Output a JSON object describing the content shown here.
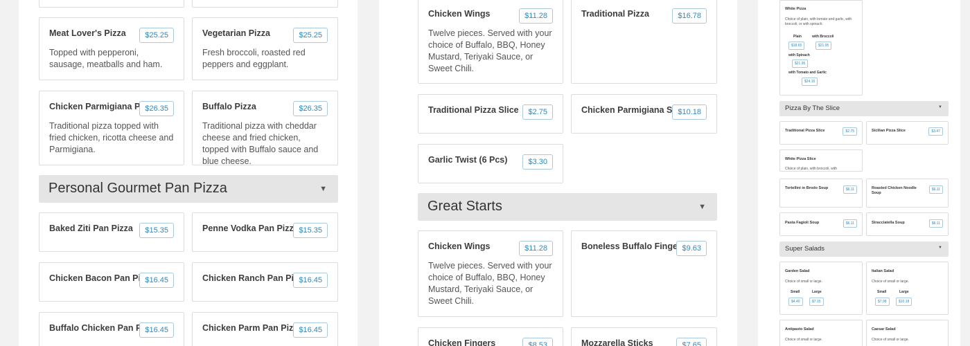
{
  "left": {
    "cards": [
      {
        "name": "Meat Lover's Pizza",
        "price": "$25.25",
        "desc": "Topped with pepperoni, sausage, meatballs and ham."
      },
      {
        "name": "Vegetarian Pizza",
        "price": "$25.25",
        "desc": "Fresh broccoli, roasted red peppers and eggplant."
      },
      {
        "name": "Chicken Parmigiana Pizza",
        "price": "$26.35",
        "desc": "Traditional pizza topped with fried chicken, ricotta cheese and Parmigiana."
      },
      {
        "name": "Buffalo Pizza",
        "price": "$26.35",
        "desc": "Traditional pizza with cheddar cheese and fried chicken, topped with Buffalo sauce and blue cheese."
      }
    ],
    "section": {
      "title": "Personal Gourmet Pan Pizza",
      "caret": "▼"
    },
    "pan_cards": [
      {
        "name": "Baked Ziti Pan Pizza",
        "price": "$15.35"
      },
      {
        "name": "Penne Vodka Pan Pizza",
        "price": "$15.35"
      },
      {
        "name": "Chicken Bacon Pan Pizza",
        "price": "$16.45"
      },
      {
        "name": "Chicken Ranch Pan Pizza",
        "price": "$16.45"
      },
      {
        "name": "Buffalo Chicken Pan Pizza",
        "price": "$16.45"
      },
      {
        "name": "Chicken Parm Pan Pizza",
        "price": "$16.45"
      }
    ]
  },
  "mid": {
    "cards_top": [
      {
        "name": "Chicken Wings",
        "price": "$11.28",
        "desc": "Twelve pieces. Served with your choice of Buffalo, BBQ, Honey Mustard, Teriyaki Sauce, or Sweet Chili."
      },
      {
        "name": "Traditional Pizza",
        "price": "$16.78"
      },
      {
        "name": "Traditional Pizza Slice",
        "price": "$2.75"
      },
      {
        "name": "Chicken Parmigiana Sub",
        "price": "$10.18"
      },
      {
        "name": "Garlic Twist (6 Pcs)",
        "price": "$3.30"
      }
    ],
    "section": {
      "title": "Great Starts",
      "caret": "▼"
    },
    "starts_cards": [
      {
        "name": "Chicken Wings",
        "price": "$11.28",
        "desc": "Twelve pieces. Served with your choice of Buffalo, BBQ, Honey Mustard, Teriyaki Sauce, or Sweet Chili."
      },
      {
        "name": "Boneless Buffalo Fingers",
        "price": "$9.63"
      },
      {
        "name": "Chicken Fingers",
        "price": "$8.53"
      },
      {
        "name": "Mozzarella Sticks",
        "price": "$7.65"
      }
    ]
  },
  "right": {
    "white_pizza": {
      "name": "White Pizza",
      "desc": "Choice of plain, with tomato and garlic, with broccoli, or with spinach.",
      "plain_label": "Plain",
      "plain_price": "$18.65",
      "broccoli_label": "with Broccoli",
      "broccoli_price": "$21.95",
      "spinach_label": "with Spinach",
      "spinach_price": "$21.95",
      "tomato_label": "with Tomato and Garlic",
      "tomato_price": "$24.15"
    },
    "slice_header": {
      "title": "Pizza By The Slice",
      "caret": "▼"
    },
    "slice_cards": [
      {
        "name": "Traditional Pizza Slice",
        "price": "$2.75"
      },
      {
        "name": "Sicilian Pizza Slice",
        "price": "$3.47"
      }
    ],
    "white_slice": {
      "name": "White Pizza Slice",
      "desc": "Choice of plain, with broccoli, with"
    },
    "soup_cards": [
      {
        "name": "Tortellini in Brodo Soup",
        "price": "$6.11"
      },
      {
        "name": "Roasted Chicken Noodle Soup",
        "price": "$6.11"
      },
      {
        "name": "Pasta Fagioli Soup",
        "price": "$6.11"
      },
      {
        "name": "Stracciatella Soup",
        "price": "$6.11"
      }
    ],
    "salads_header": {
      "title": "Super Salads",
      "caret": "▼"
    },
    "salad_cards": [
      {
        "name": "Garden Salad",
        "desc": "Choice of small or large.",
        "small": "Small",
        "small_price": "$4.40",
        "large": "Large",
        "large_price": "$7.15"
      },
      {
        "name": "Italian Salad",
        "desc": "Choice of small or large.",
        "small": "Small",
        "small_price": "$7.98",
        "large": "Large",
        "large_price": "$10.18"
      },
      {
        "name": "Antipasto Salad",
        "desc": "Choice of small or large."
      },
      {
        "name": "Caesar Salad",
        "desc": "Choice of small or large."
      }
    ]
  }
}
